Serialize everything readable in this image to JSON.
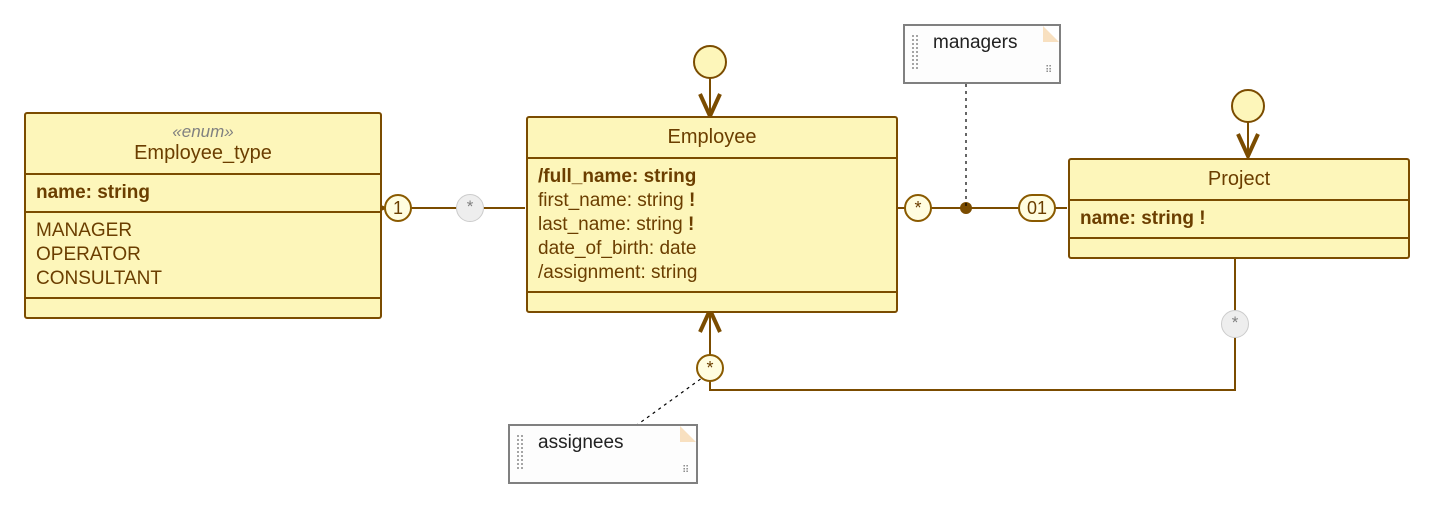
{
  "classes": {
    "employee_type": {
      "stereotype": "«enum»",
      "name": "Employee_type",
      "pk": "name: string",
      "literals": [
        "MANAGER",
        "OPERATOR",
        "CONSULTANT"
      ]
    },
    "employee": {
      "name": "Employee",
      "pk": "/full_name: string",
      "attrs": [
        {
          "txt": "first_name: string",
          "mandatory": true
        },
        {
          "txt": "last_name: string",
          "mandatory": true
        },
        {
          "txt": "date_of_birth: date",
          "mandatory": false
        },
        {
          "txt": "/assignment: string",
          "mandatory": false
        }
      ]
    },
    "project": {
      "name": "Project",
      "pk": {
        "txt": "name: string",
        "mandatory": true
      }
    }
  },
  "notes": {
    "managers": "managers",
    "assignees": "assignees"
  },
  "mult": {
    "emp_type_to_emp_left": "1",
    "emp_type_to_emp_right": "*",
    "emp_proj_left": "*",
    "emp_proj_right": "01",
    "emp_assignees": "*",
    "proj_assignees": "*"
  }
}
